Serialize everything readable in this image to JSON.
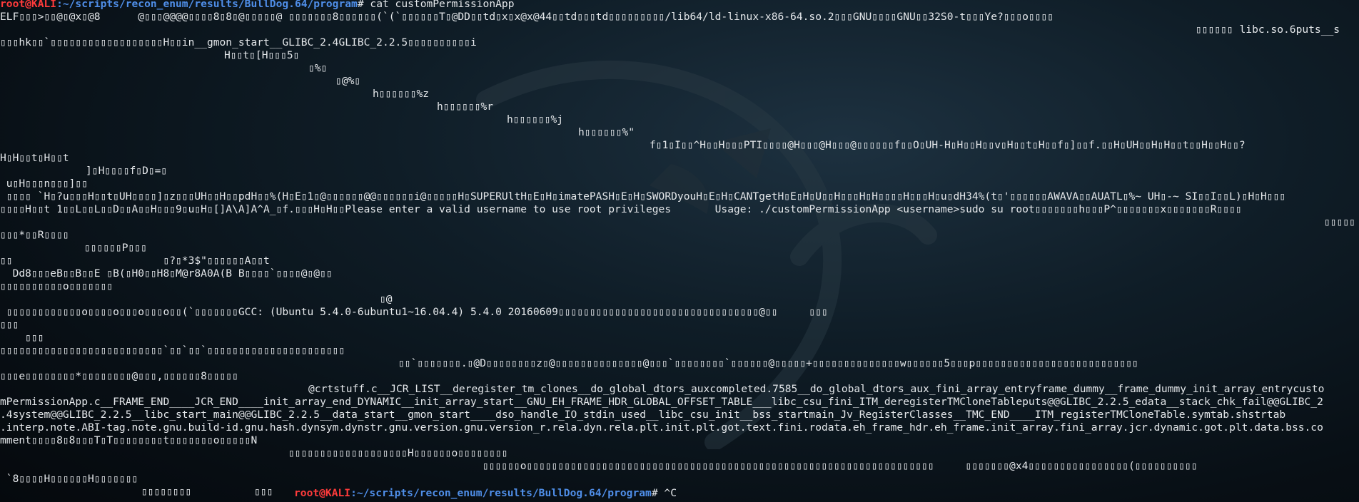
{
  "terminal": {
    "prompt_first": {
      "user_host": "root@KALI",
      "path": ":~/scripts/recon_enum/results/BullDog.64/program",
      "symbol": "# ",
      "command": "cat customPermissionApp"
    },
    "lines": [
      {
        "text": "ELF▯▯▯>▯▯@▯@x▯@8      @▯▯▯@@@@▯▯▯▯8▯8▯@▯▯▯▯▯@ ▯▯▯▯▯▯▯8▯▯▯▯▯▯(`(`▯▯▯▯▯▯T▯@DD▯▯td▯x▯x@x@44▯▯td▯▯▯td▯▯▯▯▯▯▯▯▯/lib64/ld-linux-x86-64.so.2▯▯▯GNU▯▯▯▯GNU▯▯32S0-t▯▯▯Ye?▯▯▯o▯▯▯▯",
        "indent": 0
      },
      {
        "text": "▯▯▯▯▯▯ libc.so.6puts__s",
        "indent": 1675
      },
      {
        "text": "▯▯▯hk▯▯`▯▯▯▯▯▯▯▯▯▯▯▯▯▯▯▯▯▯H▯▯in__gmon_start__GLIBC_2.4GLIBC_2.2.5▯▯▯▯▯▯▯▯▯▯i",
        "indent": 0
      },
      {
        "text": "H▯▯t▯[H▯▯▯5▯",
        "indent": 314
      },
      {
        "text": "▯%▯",
        "indent": 432
      },
      {
        "text": "▯@%▯",
        "indent": 470
      },
      {
        "text": "h▯▯▯▯▯▯%z",
        "indent": 522
      },
      {
        "text": "h▯▯▯▯▯▯%r",
        "indent": 612
      },
      {
        "text": "h▯▯▯▯▯▯%j",
        "indent": 710
      },
      {
        "text": "h▯▯▯▯▯▯%\"",
        "indent": 810
      },
      {
        "text": "f▯1▯I▯▯^H▯▯H▯▯▯PTI▯▯▯▯@H▯▯▯@H▯▯▯@▯▯▯▯▯▯f▯▯O▯UH-H▯H▯▯H▯▯v▯H▯▯t▯H▯▯f▯]▯▯f.▯▯H▯UH▯▯H▯H▯▯t▯▯H▯▯H▯▯?",
        "indent": 910
      },
      {
        "text": "H▯H▯▯t▯H▯▯t",
        "indent": 0
      },
      {
        "text": "]▯H▯▯▯▯f▯D▯=▯",
        "indent": 120
      },
      {
        "text": " u▯H▯▯▯n▯▯▯]▯▯",
        "indent": 0
      },
      {
        "text": " ▯▯▯▯ `H▯?u▯▯▯H▯▯t▯UH▯▯▯▯]▯z▯▯▯UH▯▯H▯▯pdH▯▯%(H▯E▯1▯@▯▯▯▯▯▯@@▯▯▯▯▯▯i@▯▯▯▯▯H▯SUPERUltH▯E▯H▯imatePASH▯E▯H▯SWORDyouH▯E▯H▯CANTgetH▯E▯H▯U▯▯H▯▯▯H▯H▯▯▯▯H▯▯▯H▯u▯dH34%(t▯'▯▯▯▯▯▯AWAVA▯▯AUATL▯%~ UH▯-~ SI▯▯I▯▯L)▯H▯H▯▯▯",
        "indent": 0
      },
      {
        "text": "▯▯▯▯H▯▯t 1▯▯L▯▯L▯▯D▯▯A▯▯H▯▯▯9▯u▯H▯[]A\\A]A^A_▯f.▯▯▯H▯H▯▯Please enter a valid username to use root privileges       Usage: ./customPermissionApp <username>sudo su root▯▯▯▯▯▯▯h▯▯▯P^▯▯▯▯▯▯▯x▯▯▯▯▯▯▯R▯▯▯▯",
        "indent": 0
      },
      {
        "text": "▯▯▯▯▯",
        "indent": 1855
      },
      {
        "text": "▯▯▯*▯▯R▯▯▯▯",
        "indent": 0
      },
      {
        "text": "▯▯▯▯▯▯P▯▯▯",
        "indent": 118
      },
      {
        "text": "▯▯                        ▯?▯*3$\"▯▯▯▯▯▯A▯▯t",
        "indent": 0
      },
      {
        "text": "  Dd8▯▯▯eB▯▯B▯▯E ▯B(▯H0▯▯H8▯M@r8A0A(B B▯▯▯▯`▯▯▯▯@▯@▯▯",
        "indent": 0
      },
      {
        "text": "▯▯▯▯▯▯▯▯▯▯o▯▯▯▯▯▯▯",
        "indent": 0
      },
      {
        "text": "▯@",
        "indent": 532
      },
      {
        "text": " ▯▯▯▯▯▯▯▯▯▯▯▯o▯▯▯▯o▯▯▯o▯▯▯o▯▯(`▯▯▯▯▯▯▯GCC: (Ubuntu 5.4.0-6ubuntu1~16.04.4) 5.4.0 20160609▯▯▯▯▯▯▯▯▯▯▯▯▯▯▯▯▯▯▯▯▯▯▯▯▯▯▯▯▯▯▯▯@▯▯     ▯▯▯",
        "indent": 0
      },
      {
        "text": "▯▯▯",
        "indent": 0
      },
      {
        "text": "    ▯▯▯",
        "indent": 0
      },
      {
        "text": "▯▯▯▯▯▯▯▯▯▯▯▯▯▯▯▯▯▯▯▯▯▯▯▯▯▯`▯▯`▯▯`▯▯▯▯▯▯▯▯▯▯▯▯▯▯▯▯▯▯▯▯▯▯",
        "indent": 0
      },
      {
        "text": "▯▯`▯▯▯▯▯▯▯.▯@D▯▯▯▯▯▯▯▯z▯@▯▯▯▯▯▯▯▯▯▯▯▯▯▯@▯▯▯`▯▯▯▯▯▯▯▯`▯▯▯▯▯▯@▯▯▯▯▯+▯▯▯▯▯▯▯▯▯▯▯▯▯▯w▯▯▯▯▯▯5▯▯▯p▯▯▯▯▯▯▯▯▯▯▯▯▯▯▯▯▯▯▯▯▯▯▯▯▯▯",
        "indent": 558
      },
      {
        "text": "▯▯▯e▯▯▯▯▯▯▯▯*▯▯▯▯▯▯▯▯@▯▯▯,▯▯▯▯▯▯8▯▯▯▯▯",
        "indent": 0
      },
      {
        "text": "@crtstuff.c__JCR_LIST__deregister_tm_clones__do_global_dtors_auxcompleted.7585__do_global_dtors_aux_fini_array_entryframe_dummy__frame_dummy_init_array_entrycusto",
        "indent": 432
      },
      {
        "text": "mPermissionApp.c__FRAME_END____JCR_END____init_array_end_DYNAMIC__init_array_start__GNU_EH_FRAME_HDR_GLOBAL_OFFSET_TABLE___libc_csu_fini_ITM_deregisterTMCloneTableputs@@GLIBC_2.2.5_edata__stack_chk_fail@@GLIBC_2",
        "indent": 0
      },
      {
        "text": ".4system@@GLIBC_2.2.5__libc_start_main@@GLIBC_2.2.5__data_start__gmon_start____dso_handle_IO_stdin_used__libc_csu_init__bss_startmain_Jv_RegisterClasses__TMC_END____ITM_registerTMCloneTable.symtab.shstrtab",
        "indent": 0
      },
      {
        "text": ".interp.note.ABI-tag.note.gnu.build-id.gnu.hash.dynsym.dynstr.gnu.version.gnu.version_r.rela.dyn.rela.plt.init.plt.got.text.fini.rodata.eh_frame_hdr.eh_frame.init_array.fini_array.jcr.dynamic.got.plt.data.bss.co",
        "indent": 0
      },
      {
        "text": "mment▯▯▯▯8▯8▯▯▯T▯T▯▯▯▯▯▯▯▯t▯▯▯▯▯▯▯o▯▯▯▯▯N",
        "indent": 0
      },
      {
        "text": "▯▯▯▯▯▯▯▯▯▯▯▯▯▯▯▯▯▯▯H▯▯▯▯▯▯o▯▯▯▯▯▯▯▯",
        "indent": 404
      },
      {
        "text": "▯▯▯▯▯▯o▯▯▯▯▯▯▯▯▯▯▯▯▯▯▯▯▯▯▯▯▯▯▯▯▯▯▯▯▯▯▯▯▯▯▯▯▯▯▯▯▯▯▯▯▯▯▯▯▯▯▯▯▯▯▯▯▯▯▯▯▯▯▯▯▯     ▯▯▯▯▯▯▯@x4▯▯▯▯▯▯▯▯▯▯▯▯▯▯▯▯(▯▯▯▯▯▯▯▯▯▯",
        "indent": 676
      },
      {
        "text": " `8▯▯▯▯H▯▯▯▯▯▯H▯▯▯▯▯▯▯",
        "indent": 0
      },
      {
        "text": "▯▯▯▯▯▯▯▯          ▯▯▯",
        "indent": 198
      }
    ],
    "prompt_last": {
      "user_host": "root@KALI",
      "path": ":~/scripts/recon_enum/results/BullDog.64/program",
      "symbol": "# ",
      "command": "^C"
    }
  }
}
